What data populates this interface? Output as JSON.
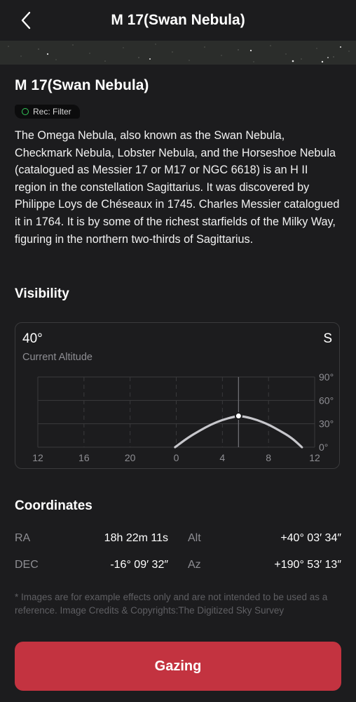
{
  "header": {
    "title": "M 17(Swan Nebula)"
  },
  "object": {
    "name": "M 17(Swan Nebula)",
    "badge": "Rec: Filter",
    "description": "The Omega Nebula, also known as the Swan Nebula, Checkmark Nebula, Lobster Nebula, and the Horseshoe Nebula (catalogued as Messier 17 or M17 or NGC 6618) is an H II region in the constellation Sagittarius. It was discovered by Philippe Loys de Chéseaux in 1745. Charles Messier catalogued it in 1764. It is by some of the richest starfields of the Milky Way, figuring in the northern two-thirds of Sagittarius."
  },
  "visibility": {
    "title": "Visibility",
    "current_altitude": "40°",
    "current_altitude_label": "Current Altitude",
    "direction": "S"
  },
  "chart_data": {
    "type": "line",
    "x_tick_labels": [
      "12",
      "16",
      "20",
      "0",
      "4",
      "8",
      "12"
    ],
    "y_tick_labels": [
      "90°",
      "60°",
      "30°",
      "0°"
    ],
    "ylim": [
      0,
      90
    ],
    "xlim_hours": [
      12,
      36
    ],
    "series": [
      {
        "x": [
          23.9,
          25.0,
          26.0,
          27.0,
          28.0,
          29.0,
          29.4,
          30.0,
          31.0,
          32.0,
          33.0,
          34.0,
          34.9
        ],
        "y": [
          0,
          12,
          21,
          29,
          35,
          39,
          40,
          39,
          35,
          29,
          21,
          12,
          0
        ]
      }
    ],
    "current_x": 29.4,
    "current_y": 40,
    "grid": true
  },
  "coordinates": {
    "title": "Coordinates",
    "ra_label": "RA",
    "ra_value": "18h 22m 11s",
    "alt_label": "Alt",
    "alt_value": "+40° 03′ 34″",
    "dec_label": "DEC",
    "dec_value": "-16° 09′ 32″",
    "az_label": "Az",
    "az_value": "+190° 53′ 13″"
  },
  "footnote": "* Images are for example effects only and are not intended to be used as a reference. Image Credits & Copyrights:The Digitized Sky Survey",
  "actions": {
    "gazing_label": "Gazing"
  },
  "colors": {
    "background": "#1c1c1e",
    "accent": "#c33340",
    "badge_dot": "#34c759"
  }
}
